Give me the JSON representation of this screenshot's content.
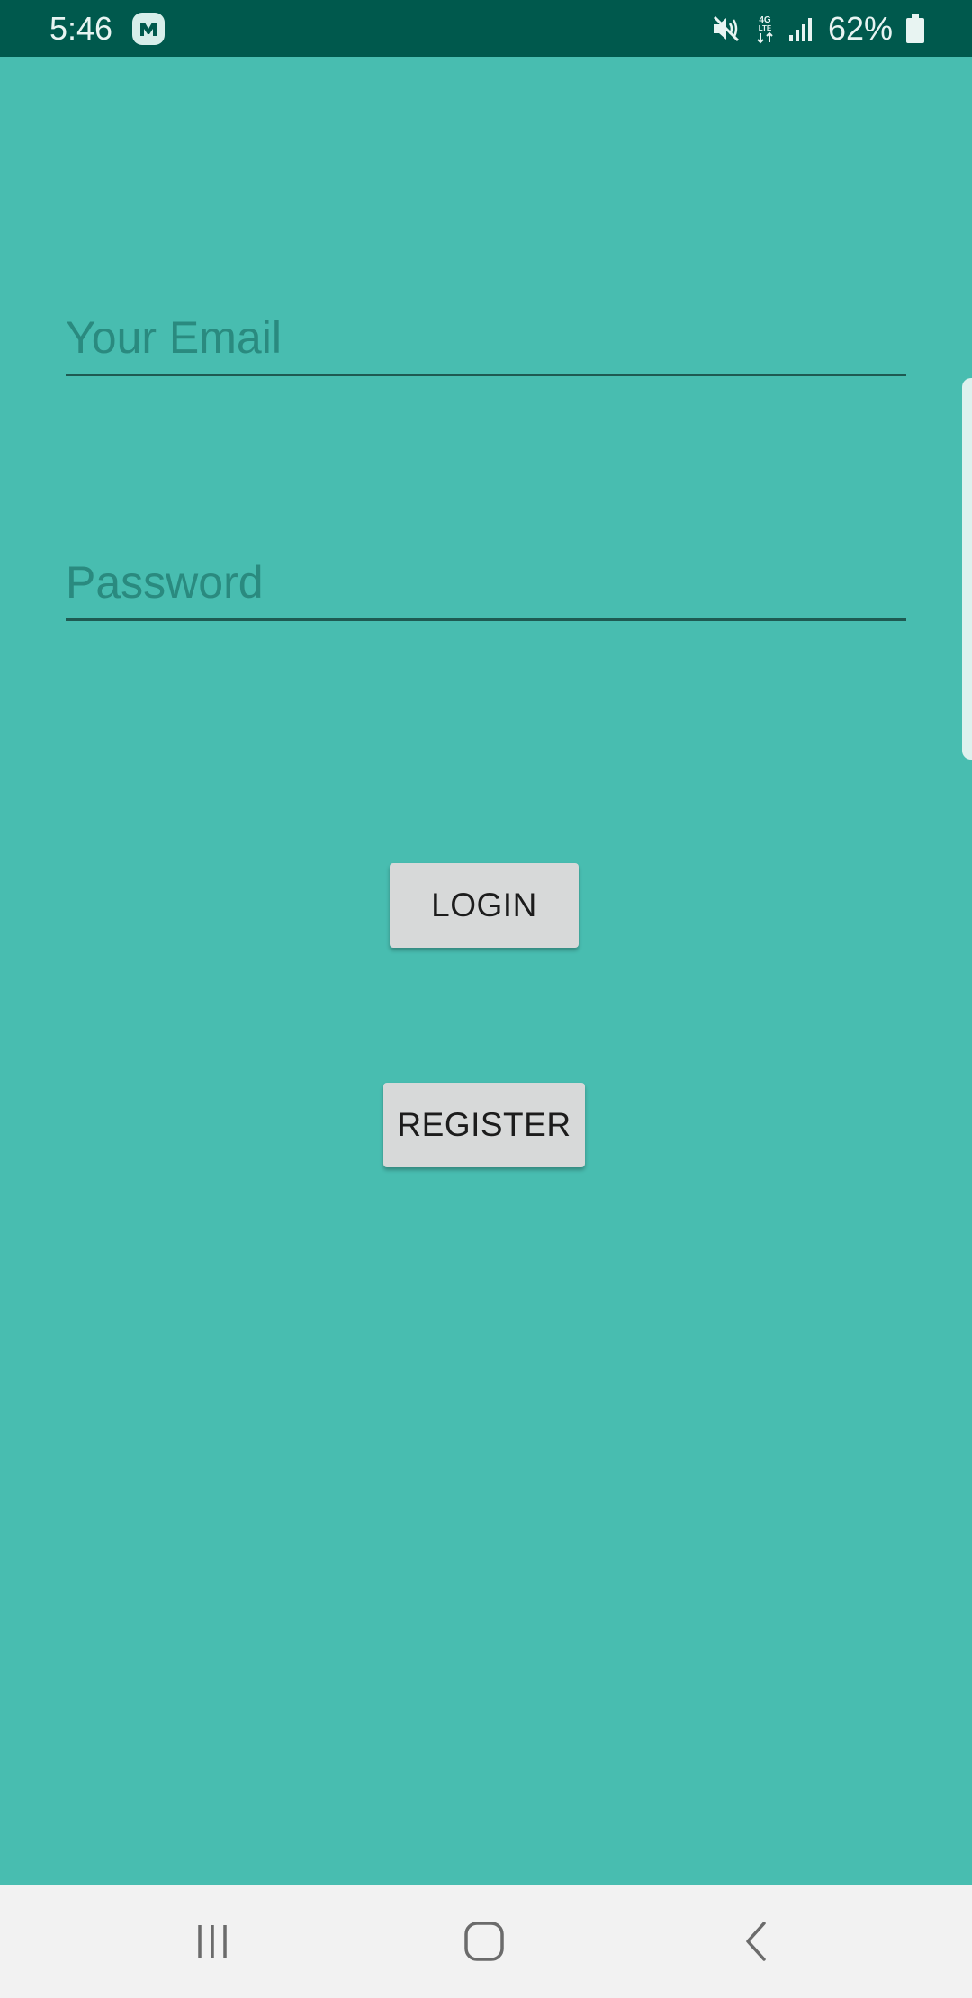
{
  "status_bar": {
    "time": "5:46",
    "battery": "62%",
    "icons": [
      "messenger-notification-icon",
      "mute-icon",
      "lte-data-icon",
      "signal-icon",
      "battery-icon"
    ]
  },
  "form": {
    "email_placeholder": "Your Email",
    "email_value": "",
    "password_placeholder": "Password",
    "password_value": ""
  },
  "buttons": {
    "login": "LOGIN",
    "register": "REGISTER"
  },
  "nav_bar": {
    "icons": [
      "recents-icon",
      "home-icon",
      "back-icon"
    ]
  },
  "colors": {
    "background": "#48bdb0",
    "status_bar": "#00594d",
    "button": "#d7d9d9",
    "field_underline": "#1e5a52",
    "nav_bar": "#f2f2f2"
  }
}
